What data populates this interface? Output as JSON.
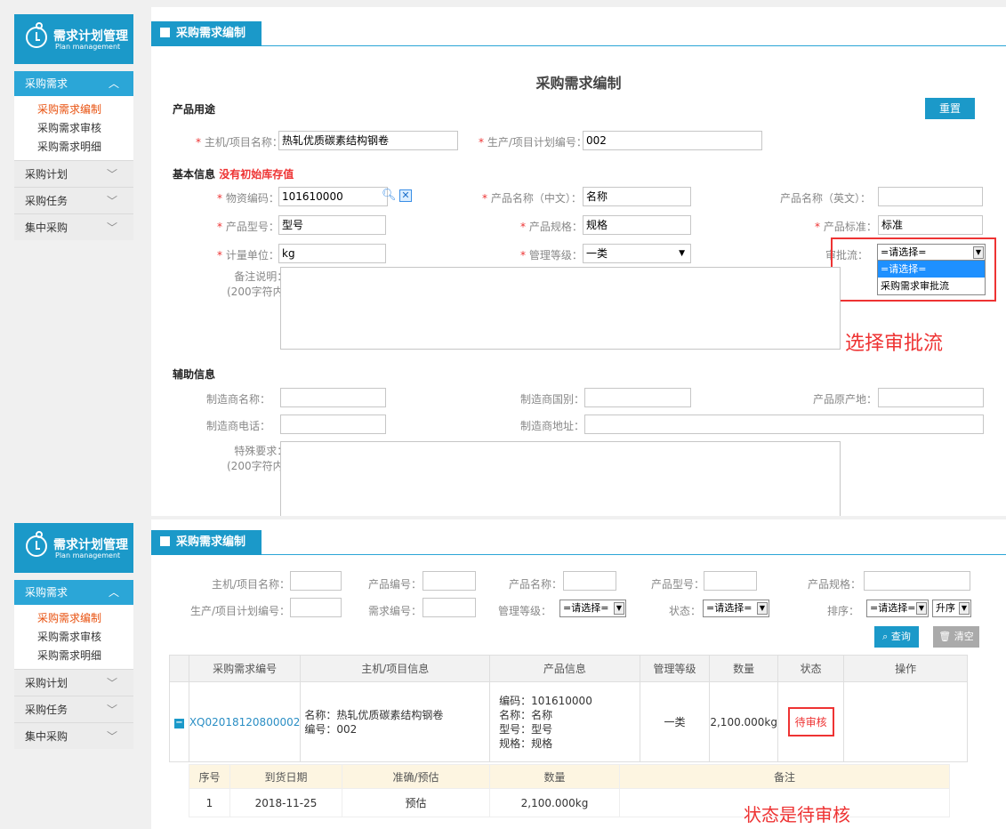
{
  "app": {
    "title": "需求计划管理",
    "subtitle": "Plan management"
  },
  "nav": {
    "active": "采购需求",
    "sub": [
      "采购需求编制",
      "采购需求审核",
      "采购需求明细"
    ],
    "items": [
      "采购计划",
      "采购任务",
      "集中采购"
    ]
  },
  "top": {
    "tab": "采购需求编制",
    "page_title": "采购需求编制",
    "section_use": "产品用途",
    "reset": "重置",
    "use_fields": [
      {
        "label": "主机/项目名称：",
        "value": "热轧优质碳素结构钢卷"
      },
      {
        "label": "生产/项目计划编号：",
        "value": "002"
      }
    ],
    "basic_title": "基本信息",
    "basic_warn": "没有初始库存值",
    "basic": {
      "material_code": {
        "label": "物资编码：",
        "value": "101610000"
      },
      "name_cn": {
        "label": "产品名称（中文）：",
        "value": "名称"
      },
      "name_en": {
        "label": "产品名称（英文）：",
        "value": ""
      },
      "model": {
        "label": "产品型号：",
        "value": "型号"
      },
      "spec": {
        "label": "产品规格：",
        "value": "规格"
      },
      "standard": {
        "label": "产品标准：",
        "value": "标准"
      },
      "unit": {
        "label": "计量单位：",
        "value": "kg"
      },
      "mgmt_level": {
        "label": "管理等级：",
        "value": "一类"
      },
      "approval": {
        "label": "审批流：",
        "value": "=请选择="
      },
      "remark": {
        "label": "备注说明：",
        "hint": "(200字符内)"
      }
    },
    "approval_options": [
      "=请选择=",
      "采购需求审批流"
    ],
    "annotation": "选择审批流",
    "aux_title": "辅助信息",
    "aux": {
      "maker": "制造商名称：",
      "country": "制造商国别：",
      "origin": "产品原产地：",
      "phone": "制造商电话：",
      "address": "制造商地址：",
      "special": "特殊要求：",
      "hint": "(200字符内)"
    }
  },
  "bottom": {
    "tab": "采购需求编制",
    "filters": [
      {
        "label": "主机/项目名称："
      },
      {
        "label": "产品编号："
      },
      {
        "label": "产品名称："
      },
      {
        "label": "产品型号："
      },
      {
        "label": "产品规格："
      }
    ],
    "filters2": {
      "plan_no": "生产/项目计划编号：",
      "req_no": "需求编号：",
      "level": "管理等级：",
      "level_val": "=请选择=",
      "status": "状态：",
      "status_val": "=请选择=",
      "sort": "排序：",
      "sort_val": "=请选择=",
      "order": "升序"
    },
    "search": "查询",
    "clear": "清空",
    "headers": [
      "采购需求编号",
      "主机/项目信息",
      "产品信息",
      "管理等级",
      "数量",
      "状态",
      "操作"
    ],
    "row": {
      "id": "XQ02018120800002",
      "host": [
        "名称：热轧优质碳素结构钢卷",
        "编号：002"
      ],
      "product": [
        "编码：101610000",
        "名称：名称",
        "型号：型号",
        "规格：规格"
      ],
      "level": "一类",
      "qty": "2,100.000kg",
      "status": "待审核"
    },
    "detail_headers": [
      "序号",
      "到货日期",
      "准确/预估",
      "数量",
      "备注"
    ],
    "detail_row": [
      "1",
      "2018-11-25",
      "预估",
      "2,100.000kg",
      ""
    ],
    "annotation": "状态是待审核"
  }
}
